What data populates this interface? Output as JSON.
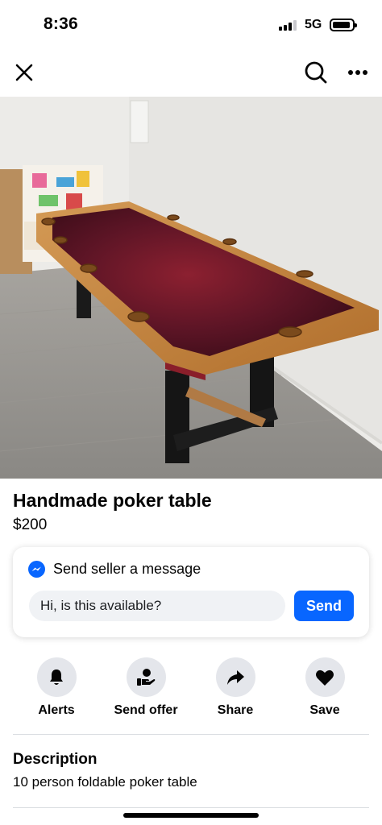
{
  "status_bar": {
    "time": "8:36",
    "network": "5G"
  },
  "nav": {
    "close_icon": "close-icon",
    "search_icon": "search-icon",
    "more_icon": "more-icon"
  },
  "listing": {
    "title": "Handmade poker table",
    "price": "$200"
  },
  "message": {
    "header": "Send seller a message",
    "input_value": "Hi, is this available?",
    "send_label": "Send"
  },
  "actions": [
    {
      "label": "Alerts",
      "icon": "bell-icon"
    },
    {
      "label": "Send offer",
      "icon": "offer-icon"
    },
    {
      "label": "Share",
      "icon": "share-icon"
    },
    {
      "label": "Save",
      "icon": "heart-icon"
    }
  ],
  "description": {
    "heading": "Description",
    "text": "10 person foldable poker table"
  },
  "colors": {
    "accent": "#0866ff",
    "action_bg": "#e4e6eb",
    "input_bg": "#f0f2f5"
  }
}
